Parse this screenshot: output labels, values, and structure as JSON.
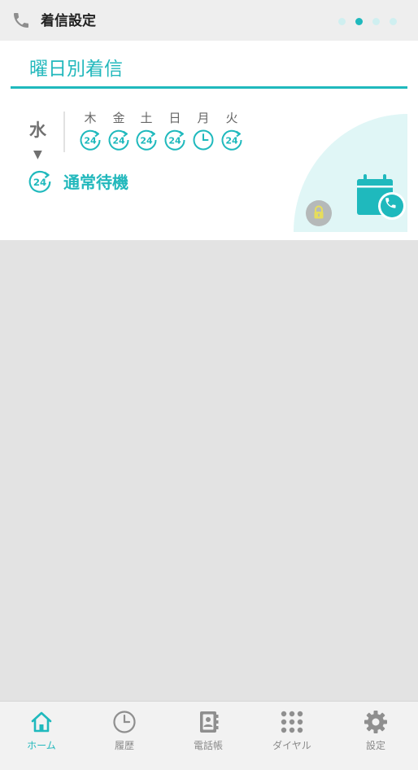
{
  "header": {
    "title": "着信設定",
    "icon": "phone-icon",
    "page_dots": 4,
    "active_dot": 1
  },
  "card": {
    "title": "曜日別着信",
    "today": "水",
    "today_arrow": "▼",
    "days": [
      {
        "label": "木",
        "icon": "24h-icon"
      },
      {
        "label": "金",
        "icon": "24h-icon"
      },
      {
        "label": "土",
        "icon": "24h-icon"
      },
      {
        "label": "日",
        "icon": "24h-icon"
      },
      {
        "label": "月",
        "icon": "clock-icon"
      },
      {
        "label": "火",
        "icon": "24h-icon"
      }
    ],
    "mode_label": "通常待機",
    "mode_icon": "24h-icon",
    "lock_icon": "lock-icon",
    "calendar_icon": "calendar-phone-icon"
  },
  "nav": {
    "items": [
      {
        "label": "ホーム",
        "icon": "home-icon",
        "active": true
      },
      {
        "label": "履歴",
        "icon": "clock-icon",
        "active": false
      },
      {
        "label": "電話帳",
        "icon": "phonebook-icon",
        "active": false
      },
      {
        "label": "ダイヤル",
        "icon": "keypad-icon",
        "active": false
      },
      {
        "label": "設定",
        "icon": "gear-icon",
        "active": false
      }
    ]
  },
  "colors": {
    "accent": "#1fb9bd",
    "accent_light": "#e0f6f6",
    "text_gray": "#8a8a8a",
    "background": "#e3e3e3"
  }
}
